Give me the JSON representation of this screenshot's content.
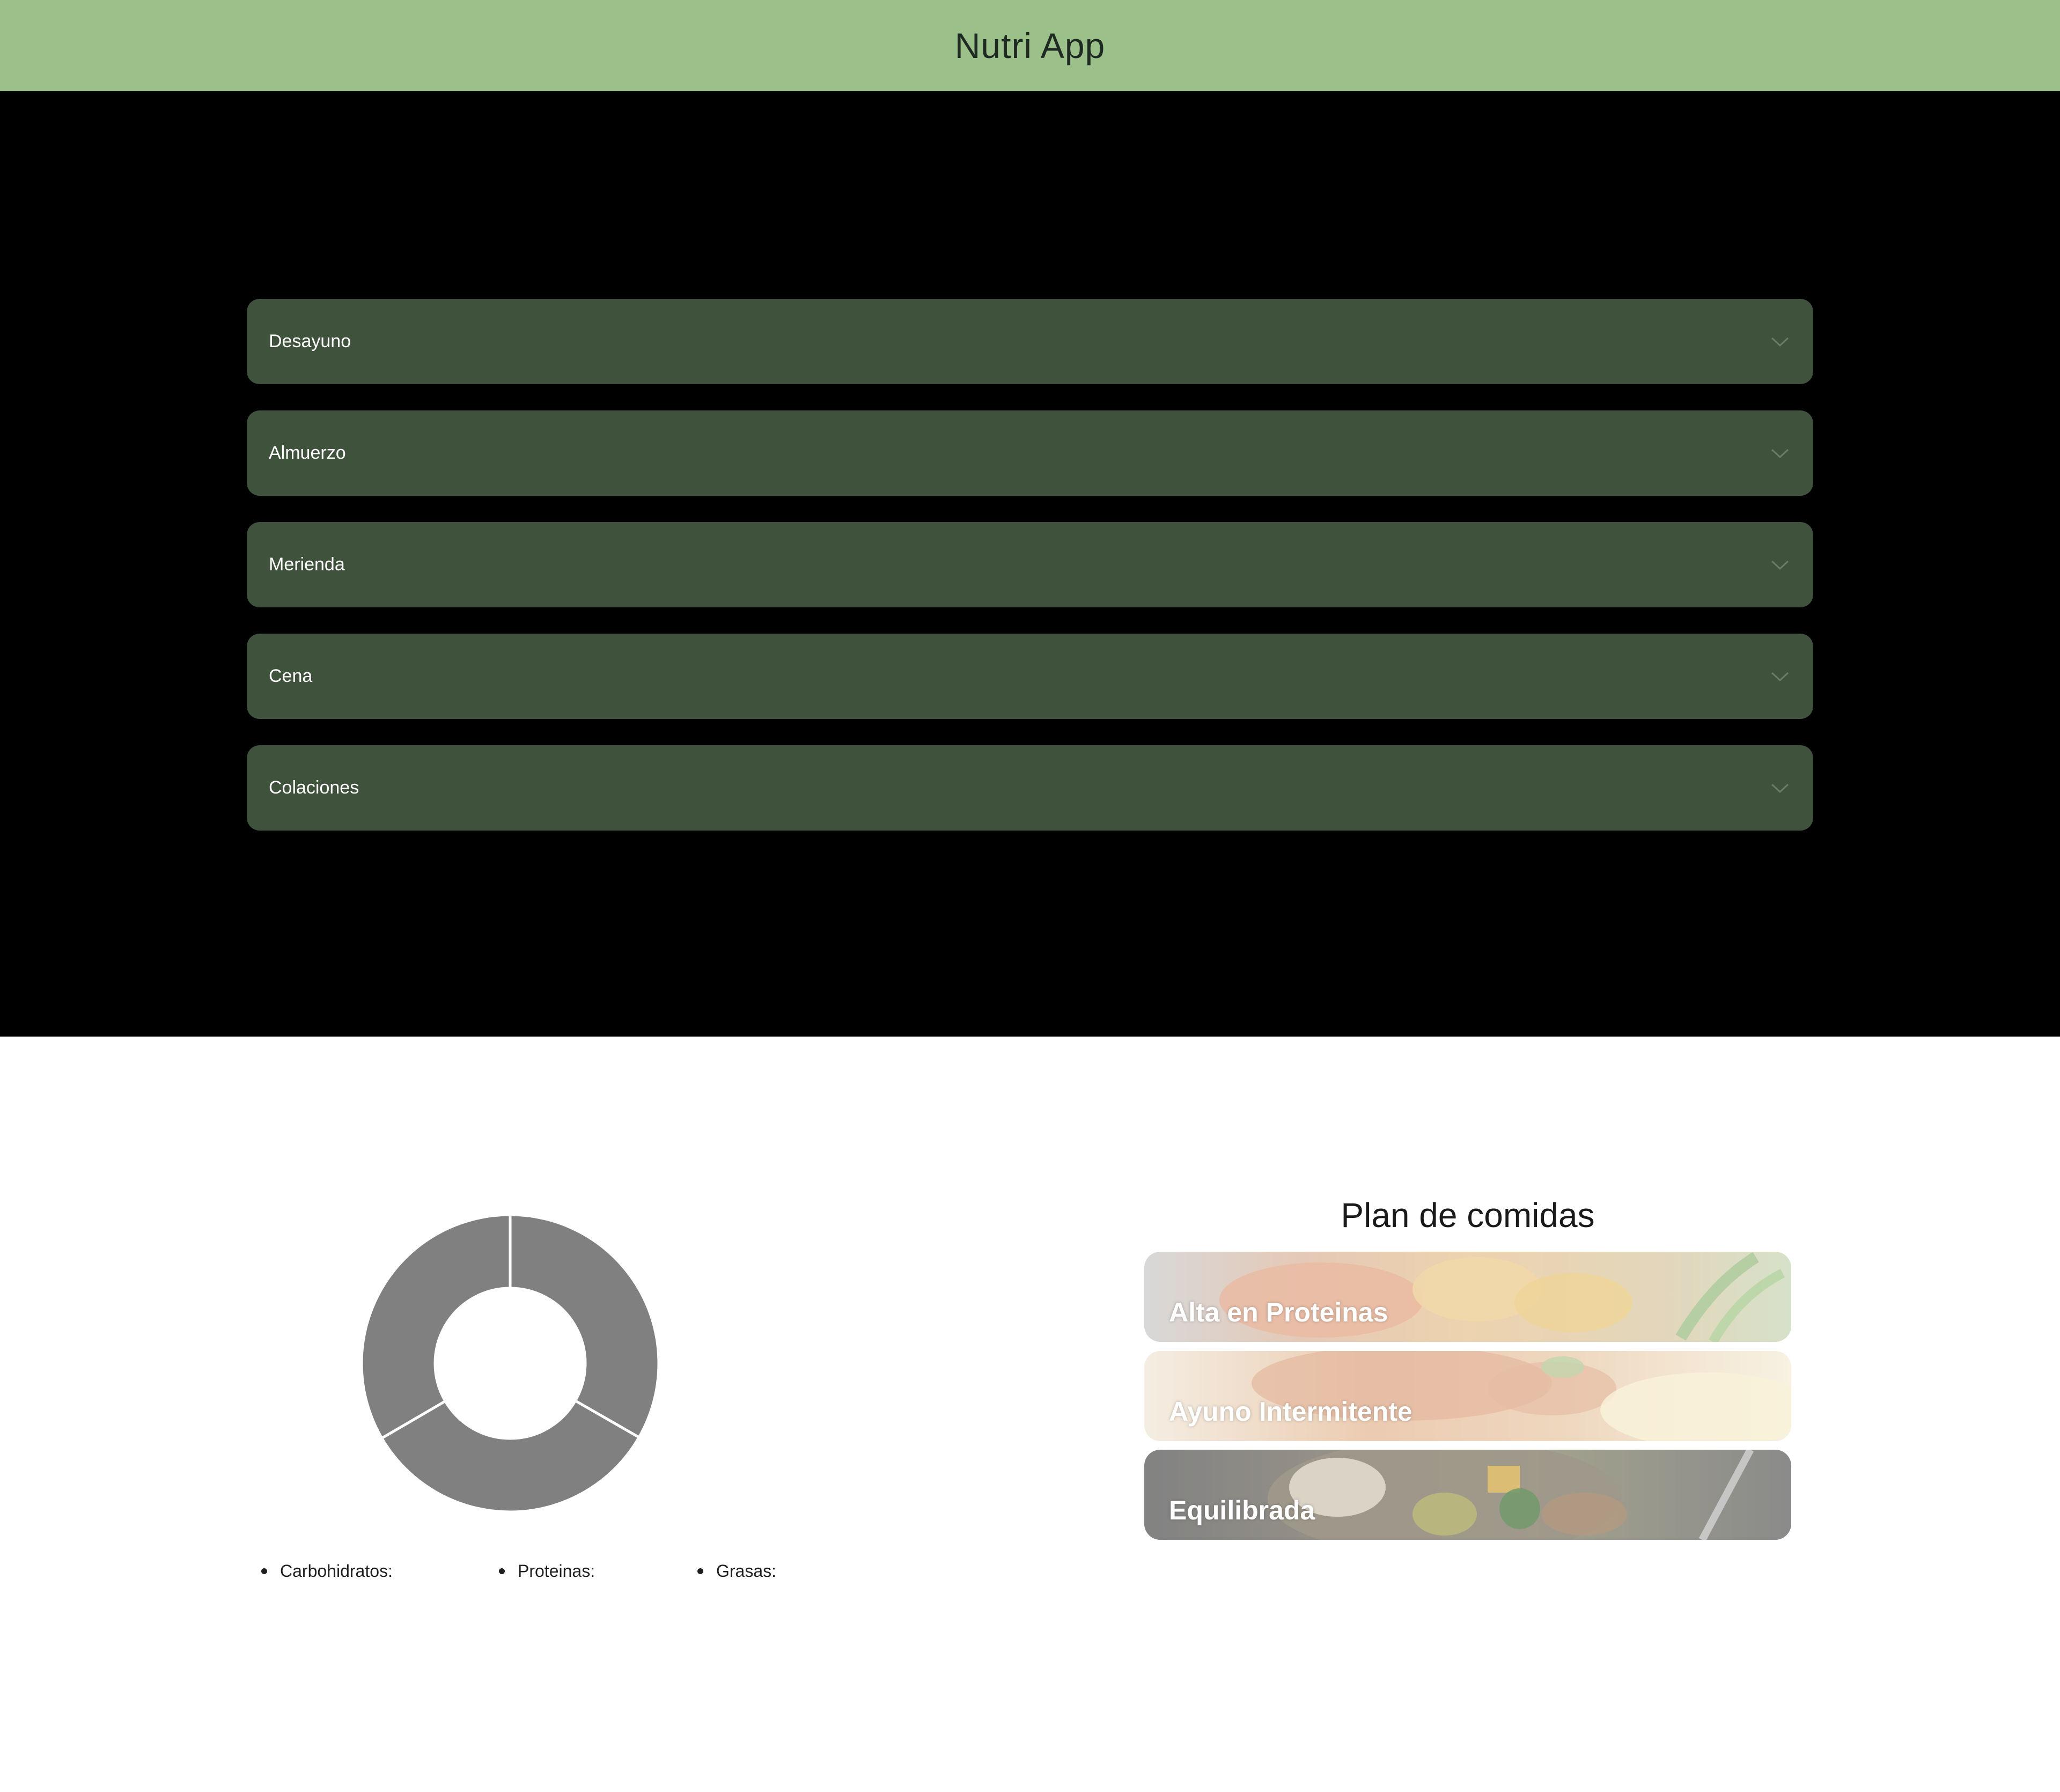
{
  "header": {
    "title": "Nutri App"
  },
  "meals": [
    {
      "label": "Desayuno"
    },
    {
      "label": "Almuerzo"
    },
    {
      "label": "Merienda"
    },
    {
      "label": "Cena"
    },
    {
      "label": "Colaciones"
    }
  ],
  "nutrients": {
    "items": [
      {
        "label": "Carbohidratos:"
      },
      {
        "label": "Proteinas:"
      },
      {
        "label": "Grasas:"
      }
    ]
  },
  "chart_data": {
    "type": "pie",
    "donut": true,
    "categories": [
      "Carbohidratos",
      "Proteinas",
      "Grasas"
    ],
    "values": [
      33.3,
      33.3,
      33.4
    ],
    "color": "#808080"
  },
  "plans": {
    "title": "Plan de comidas",
    "items": [
      {
        "label": "Alta en Proteinas"
      },
      {
        "label": "Ayuno Intermitente"
      },
      {
        "label": "Equilibrada"
      }
    ]
  },
  "colors": {
    "header_bg": "#9cc08a",
    "accordion_bg": "#3f523b",
    "dark_bg": "#000000"
  },
  "icons": {
    "expand": "chevron-down-icon"
  }
}
